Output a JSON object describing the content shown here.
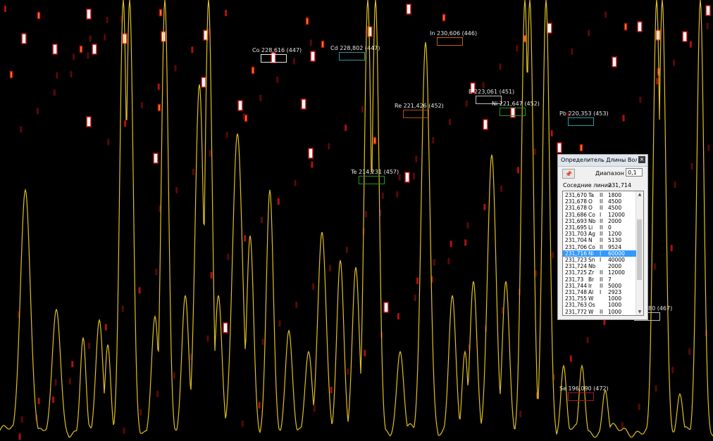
{
  "line_labels": [
    {
      "text": "Co 228,616 (447)",
      "color": "#e8e8e8"
    },
    {
      "text": "Cd 228,802 (447)",
      "color": "#3c8fa0"
    },
    {
      "text": "In 230,606 (446)",
      "color": "#c06010"
    },
    {
      "text": "Re 221,426 (452)",
      "color": "#b05010"
    },
    {
      "text": "B 223,061 (451)",
      "color": "#c0c0c0"
    },
    {
      "text": "Ni 221,647 (452)",
      "color": "#1f9a1f"
    },
    {
      "text": "Pb 220,353 (453)",
      "color": "#20a0a0"
    },
    {
      "text": "Te 214,231 (457)",
      "color": "#1f9a1f"
    },
    {
      "text": "Se 196,090 (472)",
      "color": "#b0103a"
    },
    {
      "text": "80 (467)",
      "color": "#c0c0c0"
    }
  ],
  "dialog": {
    "title": "Определитель Длины Вол...",
    "close_glyph": "×",
    "pin_glyph": "📌",
    "range_label": "Диапазон",
    "range_value": "0,1",
    "neighbors_label": "Соседние линии",
    "neighbors_value": "231,714",
    "scroll_up": "▲",
    "scroll_down": "▼",
    "rows": [
      {
        "wl": "231,670",
        "el": "Ta",
        "ion": "II",
        "int": "1800"
      },
      {
        "wl": "231,678",
        "el": "O",
        "ion": "II",
        "int": "4500"
      },
      {
        "wl": "231,678",
        "el": "O",
        "ion": "II",
        "int": "4500"
      },
      {
        "wl": "231,686",
        "el": "Co",
        "ion": "I",
        "int": "12000"
      },
      {
        "wl": "231,693",
        "el": "Nb",
        "ion": "II",
        "int": "2000"
      },
      {
        "wl": "231,695",
        "el": "Li",
        "ion": "II",
        "int": "0"
      },
      {
        "wl": "231,703",
        "el": "Ag",
        "ion": "II",
        "int": "1200"
      },
      {
        "wl": "231,704",
        "el": "N",
        "ion": "II",
        "int": "5130"
      },
      {
        "wl": "231,706",
        "el": "Co",
        "ion": "II",
        "int": "9524"
      },
      {
        "wl": "231,716",
        "el": "Ni",
        "ion": "I",
        "int": "60000"
      },
      {
        "wl": "231,723",
        "el": "Sn",
        "ion": "I",
        "int": "40000"
      },
      {
        "wl": "231,724",
        "el": "Nb",
        "ion": "",
        "int": "2000"
      },
      {
        "wl": "231,725",
        "el": "Zr",
        "ion": "II",
        "int": "12000"
      },
      {
        "wl": "231,73",
        "el": "Br",
        "ion": "II",
        "int": "7"
      },
      {
        "wl": "231,744",
        "el": "Ir",
        "ion": "II",
        "int": "5000"
      },
      {
        "wl": "231,748",
        "el": "Al",
        "ion": "I",
        "int": "2923"
      },
      {
        "wl": "231,755",
        "el": "W",
        "ion": "",
        "int": "1000"
      },
      {
        "wl": "231,763",
        "el": "Os",
        "ion": "",
        "int": "1000"
      },
      {
        "wl": "231,772",
        "el": "W",
        "ion": "II",
        "int": "1000"
      }
    ],
    "selected_index": 9
  },
  "colors": {
    "spectrum_line": "#e0c020",
    "background": "#000000",
    "selection": "#3399ff"
  }
}
